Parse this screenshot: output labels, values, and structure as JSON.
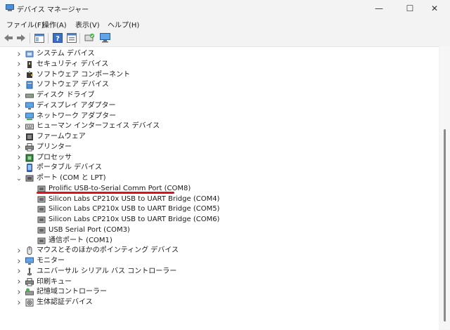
{
  "window": {
    "title": "デバイス マネージャー",
    "controls": {
      "minimize": "—",
      "maximize": "☐",
      "close": "✕"
    }
  },
  "menu": [
    "ファイル(F)",
    "操作(A)",
    "表示(V)",
    "ヘルプ(H)"
  ],
  "toolbar": {
    "buttons": [
      "back-icon",
      "forward-icon",
      "show-hide-tree-icon",
      "help-icon",
      "properties-icon",
      "scan-hardware-icon",
      "monitor-icon"
    ]
  },
  "tree": {
    "categories": [
      {
        "label": "システム デバイス",
        "icon": "system-device-icon",
        "expanded": false
      },
      {
        "label": "セキュリティ デバイス",
        "icon": "security-device-icon",
        "expanded": false
      },
      {
        "label": "ソフトウェア コンポーネント",
        "icon": "software-component-icon",
        "expanded": false
      },
      {
        "label": "ソフトウェア デバイス",
        "icon": "software-device-icon",
        "expanded": false
      },
      {
        "label": "ディスク ドライブ",
        "icon": "disk-drive-icon",
        "expanded": false
      },
      {
        "label": "ディスプレイ アダプター",
        "icon": "display-adapter-icon",
        "expanded": false
      },
      {
        "label": "ネットワーク アダプター",
        "icon": "network-adapter-icon",
        "expanded": false
      },
      {
        "label": "ヒューマン インターフェイス デバイス",
        "icon": "hid-icon",
        "expanded": false
      },
      {
        "label": "ファームウェア",
        "icon": "firmware-icon",
        "expanded": false
      },
      {
        "label": "プリンター",
        "icon": "printer-icon",
        "expanded": false
      },
      {
        "label": "プロセッサ",
        "icon": "processor-icon",
        "expanded": false
      },
      {
        "label": "ポータブル デバイス",
        "icon": "portable-device-icon",
        "expanded": false
      },
      {
        "label": "ポート (COM と LPT)",
        "icon": "port-icon",
        "expanded": true,
        "children": [
          {
            "label": "Prolific USB-to-Serial Comm Port (COM8)",
            "highlighted": true
          },
          {
            "label": "Silicon Labs CP210x USB to UART Bridge (COM4)"
          },
          {
            "label": "Silicon Labs CP210x USB to UART Bridge (COM5)"
          },
          {
            "label": "Silicon Labs CP210x USB to UART Bridge (COM6)"
          },
          {
            "label": "USB Serial Port (COM3)"
          },
          {
            "label": "通信ポート (COM1)"
          }
        ]
      },
      {
        "label": "マウスとそのほかのポインティング デバイス",
        "icon": "mouse-icon",
        "expanded": false
      },
      {
        "label": "モニター",
        "icon": "monitor-icon",
        "expanded": false
      },
      {
        "label": "ユニバーサル シリアル バス コントローラー",
        "icon": "usb-icon",
        "expanded": false
      },
      {
        "label": "印刷キュー",
        "icon": "print-queue-icon",
        "expanded": false
      },
      {
        "label": "記憶域コントローラー",
        "icon": "storage-controller-icon",
        "expanded": false
      },
      {
        "label": "生体認証デバイス",
        "icon": "biometric-icon",
        "expanded": false
      }
    ]
  },
  "colors": {
    "highlight_underline": "#e0101a",
    "tree_background": "#ffffff",
    "chrome": "#f3f3f3"
  }
}
